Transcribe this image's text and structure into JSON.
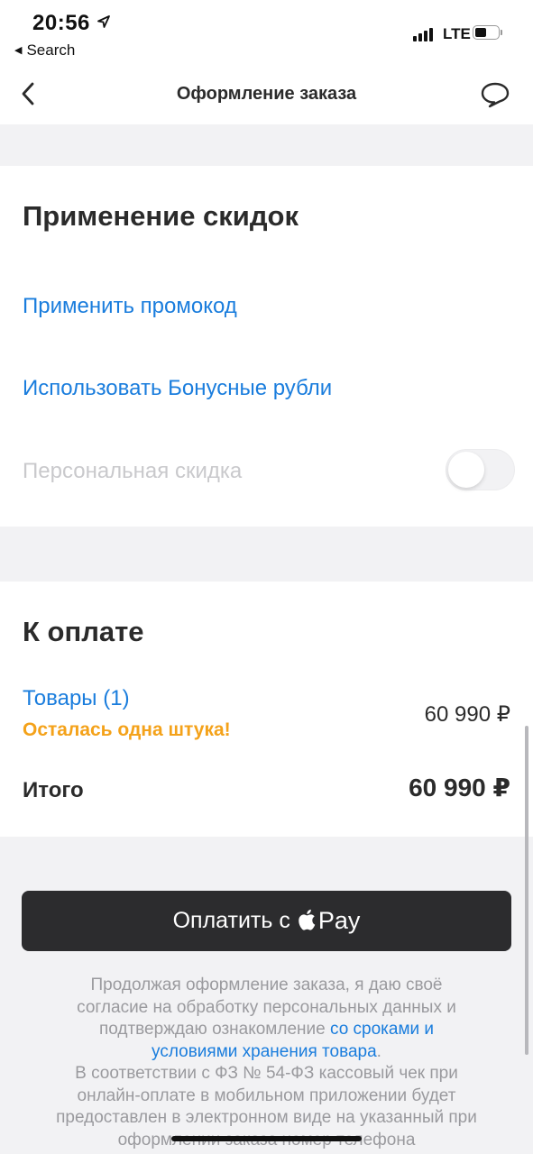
{
  "status_bar": {
    "time": "20:56",
    "back_app_label": "Search",
    "network": "LTE"
  },
  "nav": {
    "title": "Оформление заказа",
    "back_icon": "chevron-left-icon",
    "chat_icon": "chat-bubble-icon"
  },
  "discounts": {
    "heading": "Применение скидок",
    "promo_link": "Применить промокод",
    "bonus_link": "Использовать Бонусные рубли",
    "personal_label": "Персональная скидка",
    "personal_toggle_on": false
  },
  "payment": {
    "heading": "К оплате",
    "goods_link": "Товары (1)",
    "stock_warning": "Осталась одна штука!",
    "goods_price": "60 990 ₽",
    "total_label": "Итого",
    "total_price": "60 990 ₽"
  },
  "pay_button": {
    "label": "Оплатить с",
    "pay_word": "Pay"
  },
  "legal": {
    "text_1": "Продолжая оформление заказа, я даю своё согласие на обработку персональных данных и подтверждаю ознакомление ",
    "link_text": "со сроками и условиями хранения товара",
    "text_2": ".",
    "text_3": "В соответствии с ФЗ № 54-ФЗ кассовый чек при онлайн-оплате в мобильном приложении будет предоставлен в электронном виде на указанный при оформлении заказа номер телефона"
  },
  "colors": {
    "link": "#1a7ddd",
    "warning": "#f4a21a",
    "button_dark": "#2c2c2e",
    "page_bg": "#f2f2f4"
  }
}
